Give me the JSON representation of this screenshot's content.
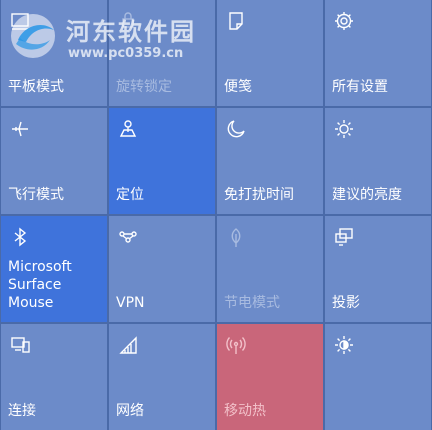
{
  "watermark": {
    "title": "河东软件园",
    "url": "www.pc0359.cn"
  },
  "tiles": [
    {
      "label": "平板模式",
      "icon": "tablet-mode-icon",
      "state": "normal"
    },
    {
      "label": "旋转锁定",
      "icon": "rotation-lock-icon",
      "state": "disabled"
    },
    {
      "label": "便笺",
      "icon": "note-icon",
      "state": "normal"
    },
    {
      "label": "所有设置",
      "icon": "gear-icon",
      "state": "normal"
    },
    {
      "label": "飞行模式",
      "icon": "airplane-icon",
      "state": "normal"
    },
    {
      "label": "定位",
      "icon": "location-icon",
      "state": "on"
    },
    {
      "label": "免打扰时间",
      "icon": "moon-icon",
      "state": "normal"
    },
    {
      "label": "建议的亮度",
      "icon": "brightness-icon",
      "state": "normal"
    },
    {
      "label": "Microsoft\nSurface Mouse",
      "icon": "bluetooth-icon",
      "state": "on"
    },
    {
      "label": "VPN",
      "icon": "vpn-icon",
      "state": "normal"
    },
    {
      "label": "节电模式",
      "icon": "battery-saver-icon",
      "state": "disabled"
    },
    {
      "label": "投影",
      "icon": "project-icon",
      "state": "normal"
    },
    {
      "label": "连接",
      "icon": "connect-icon",
      "state": "normal"
    },
    {
      "label": "网络",
      "icon": "network-icon",
      "state": "normal"
    },
    {
      "label": "移动热",
      "icon": "mobile-hotspot-icon",
      "state": "hot"
    },
    {
      "label": "",
      "icon": "brightness-half-icon",
      "state": "normal"
    }
  ],
  "colors": {
    "background": "#4a6aa8",
    "tile": "#6c8bc9",
    "tile_on": "#3f73db",
    "tile_hot": "#c9667a"
  }
}
